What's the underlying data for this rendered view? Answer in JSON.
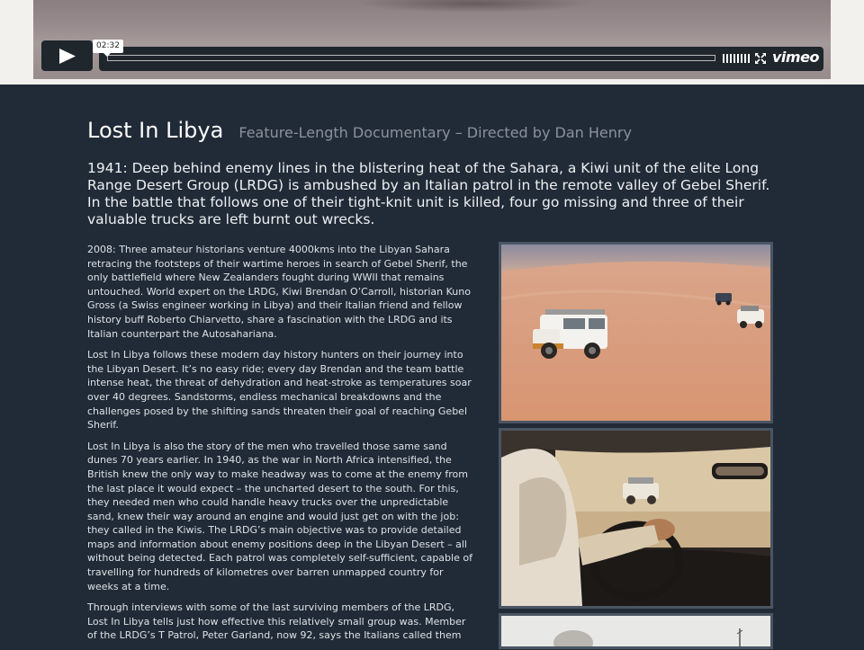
{
  "video": {
    "time_tooltip": "02:32",
    "player_brand": "vimeo",
    "icons": [
      "play-icon",
      "volume-icon",
      "fullscreen-icon",
      "vimeo-logo"
    ]
  },
  "article": {
    "title": "Lost In Libya",
    "subtitle": "Feature-Length Documentary – Directed by Dan Henry",
    "lead": "1941: Deep behind enemy lines in the blistering heat of the Sahara, a Kiwi unit of the elite Long Range Desert Group (LRDG) is ambushed by an Italian patrol in the remote valley of Gebel Sherif. In the battle that follows one of their tight-knit unit is killed, four go missing and three of their valuable trucks are left burnt out wrecks.",
    "paragraphs": [
      "2008: Three amateur historians venture 4000kms into the Libyan Sahara retracing the footsteps of their wartime heroes in search of Gebel Sherif, the only battlefield where New Zealanders fought during WWII that remains untouched. World expert on the LRDG, Kiwi Brendan O’Carroll, historian Kuno Gross (a Swiss engineer working in Libya) and their Italian friend and fellow history buff Roberto Chiarvetto, share a fascination with the LRDG and its Italian counterpart the Autosahariana.",
      "Lost In Libya follows these modern day history hunters on their journey into the Libyan Desert. It’s no easy ride; every day Brendan and the team battle intense heat, the threat of dehydration and heat-stroke as temperatures soar over 40 degrees. Sandstorms, endless mechanical breakdowns and the challenges posed by the shifting sands threaten their goal of reaching Gebel Sherif.",
      "Lost In Libya is also the story of the men who travelled those same sand dunes 70 years earlier. In 1940, as the war in North Africa intensified, the British knew the only way to make headway was to come at the enemy from the last place it would expect – the uncharted desert to the south. For this, they needed men who could handle heavy trucks over the unpredictable sand, knew their way around an engine and would just get on with the job: they called in the Kiwis. The LRDG’s main objective was to provide detailed maps and information about enemy positions deep in the Libyan Desert – all without being detected. Each patrol was completely self-sufficient, capable of travelling for hundreds of kilometres over barren unmapped country for weeks at a time.",
      "Through interviews with some of the last surviving members of the LRDG, Lost In Libya tells just how effective this relatively small group was. Member of the LRDG’s T Patrol, Peter Garland, now 92, says the Italians called them"
    ]
  },
  "colors": {
    "page_background": "#212b37",
    "top_strip": "#f3f1ed",
    "controls": "#1f262c",
    "photo_border": "#4a5563"
  }
}
